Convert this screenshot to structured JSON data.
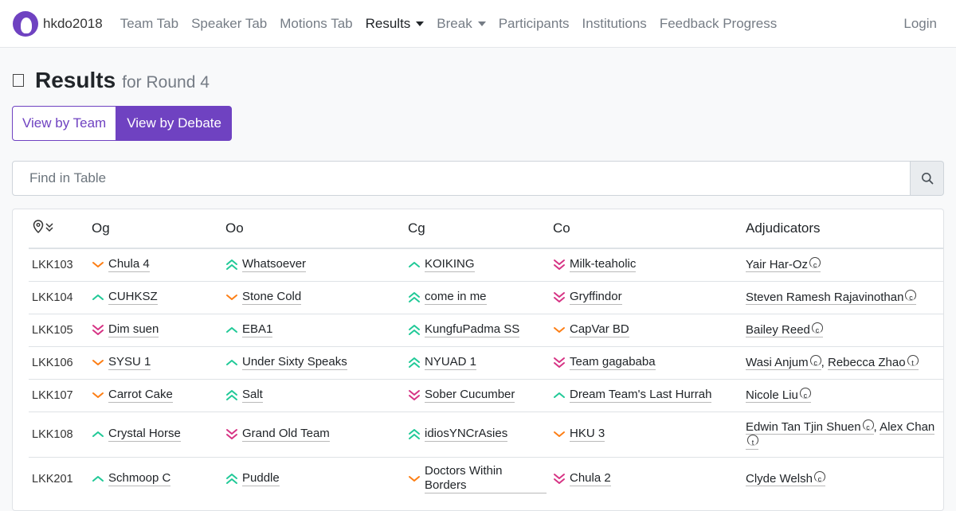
{
  "nav": {
    "brand": "hkdo2018",
    "items": [
      "Team Tab",
      "Speaker Tab",
      "Motions Tab",
      "Results",
      "Break",
      "Participants",
      "Institutions",
      "Feedback Progress"
    ],
    "login": "Login"
  },
  "page": {
    "title": "Results",
    "subtitle": "for Round 4"
  },
  "toggle": {
    "by_team": "View by Team",
    "by_debate": "View by Debate"
  },
  "search": {
    "placeholder": "Find in Table"
  },
  "table": {
    "headers": [
      "Og",
      "Oo",
      "Cg",
      "Co",
      "Adjudicators"
    ],
    "rows": [
      {
        "venue": "LKK103",
        "teams": [
          {
            "name": "Chula 4",
            "rank": "3rd"
          },
          {
            "name": "Whatsoever",
            "rank": "1st"
          },
          {
            "name": "KOIKING",
            "rank": "2nd"
          },
          {
            "name": "Milk-teaholic",
            "rank": "4th"
          }
        ],
        "adj": [
          {
            "name": "Yair Har-Oz",
            "role": "c"
          }
        ]
      },
      {
        "venue": "LKK104",
        "teams": [
          {
            "name": "CUHKSZ",
            "rank": "2nd"
          },
          {
            "name": "Stone Cold",
            "rank": "3rd"
          },
          {
            "name": "come in me",
            "rank": "1st"
          },
          {
            "name": "Gryffindor",
            "rank": "4th"
          }
        ],
        "adj": [
          {
            "name": "Steven Ramesh Rajavinothan",
            "role": "c"
          }
        ]
      },
      {
        "venue": "LKK105",
        "teams": [
          {
            "name": "Dim suen",
            "rank": "4th"
          },
          {
            "name": "EBA1",
            "rank": "2nd"
          },
          {
            "name": "KungfuPadma SS",
            "rank": "1st"
          },
          {
            "name": "CapVar BD",
            "rank": "3rd"
          }
        ],
        "adj": [
          {
            "name": "Bailey Reed",
            "role": "c"
          }
        ]
      },
      {
        "venue": "LKK106",
        "teams": [
          {
            "name": "SYSU 1",
            "rank": "3rd"
          },
          {
            "name": "Under Sixty Speaks",
            "rank": "2nd"
          },
          {
            "name": "NYUAD 1",
            "rank": "1st"
          },
          {
            "name": "Team gagababa",
            "rank": "4th"
          }
        ],
        "adj": [
          {
            "name": "Wasi Anjum",
            "role": "c"
          },
          {
            "name": "Rebecca Zhao",
            "role": "t"
          }
        ]
      },
      {
        "venue": "LKK107",
        "teams": [
          {
            "name": "Carrot Cake",
            "rank": "3rd"
          },
          {
            "name": "Salt",
            "rank": "1st"
          },
          {
            "name": "Sober Cucumber",
            "rank": "4th"
          },
          {
            "name": "Dream Team's Last Hurrah",
            "rank": "2nd"
          }
        ],
        "adj": [
          {
            "name": "Nicole Liu",
            "role": "c"
          }
        ]
      },
      {
        "venue": "LKK108",
        "teams": [
          {
            "name": "Crystal Horse",
            "rank": "2nd"
          },
          {
            "name": "Grand Old Team",
            "rank": "4th"
          },
          {
            "name": "idiosYNCrAsies",
            "rank": "1st"
          },
          {
            "name": "HKU 3",
            "rank": "3rd"
          }
        ],
        "adj": [
          {
            "name": "Edwin Tan Tjin Shuen",
            "role": "c"
          },
          {
            "name": "Alex Chan",
            "role": "t"
          }
        ]
      },
      {
        "venue": "LKK201",
        "teams": [
          {
            "name": "Schmoop C",
            "rank": "2nd"
          },
          {
            "name": "Puddle",
            "rank": "1st"
          },
          {
            "name": "Doctors Within Borders",
            "rank": "3rd"
          },
          {
            "name": "Chula 2",
            "rank": "4th"
          }
        ],
        "adj": [
          {
            "name": "Clyde Welsh",
            "role": "c"
          }
        ]
      }
    ]
  },
  "colors": {
    "accent": "#6f42c1",
    "first": "#20c997",
    "second": "#20c997",
    "third": "#fd7e14",
    "fourth": "#d63384"
  },
  "icons": {
    "venue_header": "map-pin-sort-icon",
    "search": "search-icon",
    "title": "checkbox-icon",
    "role_c": "chair-icon",
    "role_t": "trainee-icon"
  }
}
